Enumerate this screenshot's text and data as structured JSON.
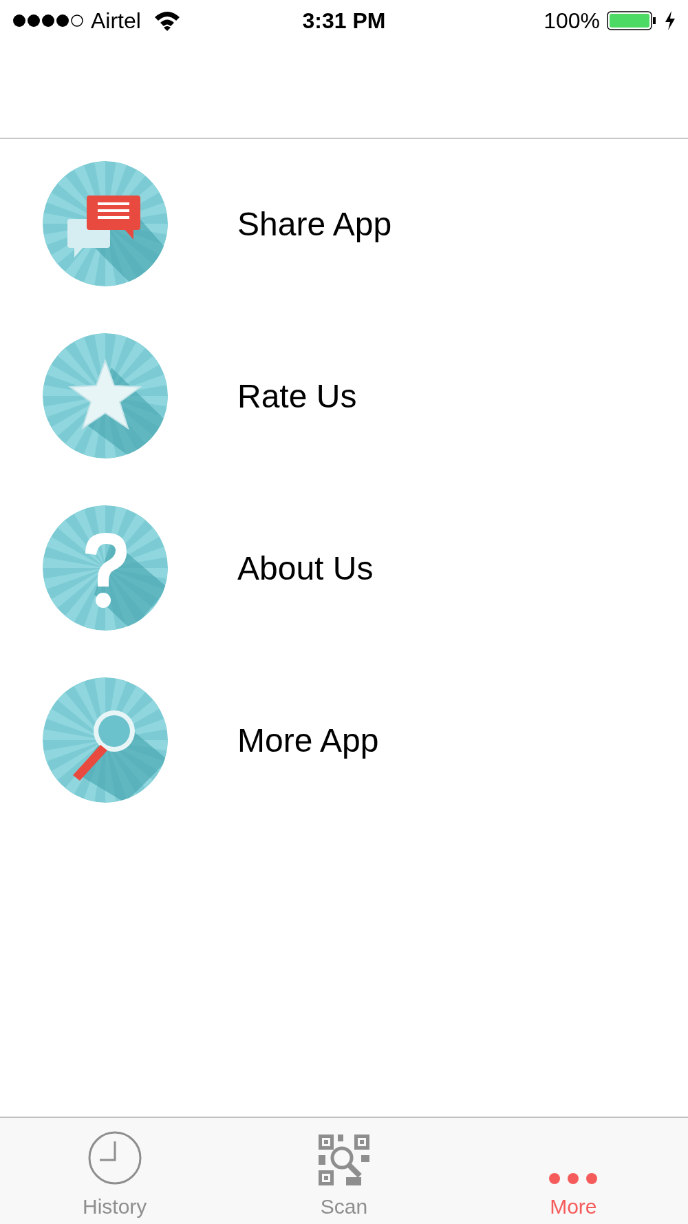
{
  "status_bar": {
    "carrier": "Airtel",
    "time": "3:31 PM",
    "battery": "100%"
  },
  "menu": [
    {
      "label": "Share App"
    },
    {
      "label": "Rate Us"
    },
    {
      "label": "About Us"
    },
    {
      "label": "More App"
    }
  ],
  "tab_bar": [
    {
      "label": "History",
      "selected": false
    },
    {
      "label": "Scan",
      "selected": false
    },
    {
      "label": "More",
      "selected": true
    }
  ]
}
